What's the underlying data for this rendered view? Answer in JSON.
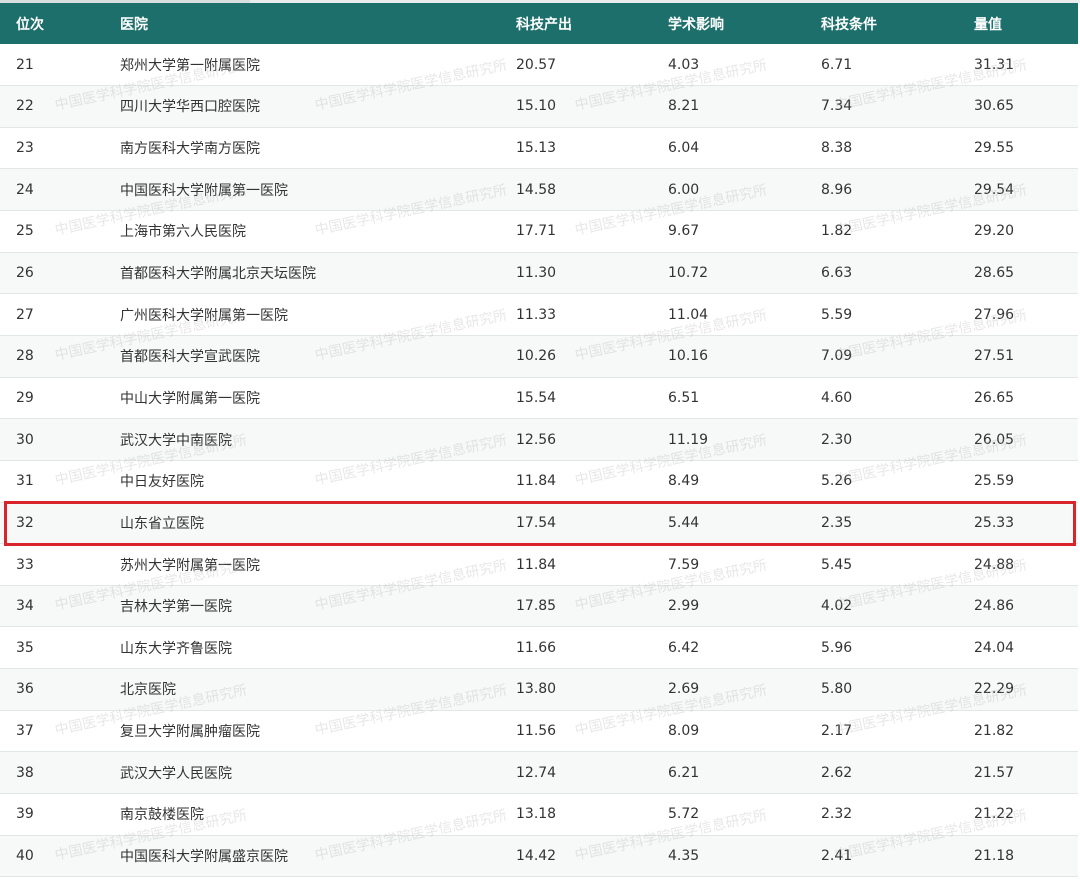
{
  "table": {
    "headers": {
      "rank": "位次",
      "hospital": "医院",
      "sci_output": "科技产出",
      "academic_impact": "学术影响",
      "sci_conditions": "科技条件",
      "score": "量值"
    },
    "rows": [
      {
        "rank": "21",
        "hospital": "郑州大学第一附属医院",
        "sci_output": "20.57",
        "academic_impact": "4.03",
        "sci_conditions": "6.71",
        "score": "31.31"
      },
      {
        "rank": "22",
        "hospital": "四川大学华西口腔医院",
        "sci_output": "15.10",
        "academic_impact": "8.21",
        "sci_conditions": "7.34",
        "score": "30.65"
      },
      {
        "rank": "23",
        "hospital": "南方医科大学南方医院",
        "sci_output": "15.13",
        "academic_impact": "6.04",
        "sci_conditions": "8.38",
        "score": "29.55"
      },
      {
        "rank": "24",
        "hospital": "中国医科大学附属第一医院",
        "sci_output": "14.58",
        "academic_impact": "6.00",
        "sci_conditions": "8.96",
        "score": "29.54"
      },
      {
        "rank": "25",
        "hospital": "上海市第六人民医院",
        "sci_output": "17.71",
        "academic_impact": "9.67",
        "sci_conditions": "1.82",
        "score": "29.20"
      },
      {
        "rank": "26",
        "hospital": "首都医科大学附属北京天坛医院",
        "sci_output": "11.30",
        "academic_impact": "10.72",
        "sci_conditions": "6.63",
        "score": "28.65"
      },
      {
        "rank": "27",
        "hospital": "广州医科大学附属第一医院",
        "sci_output": "11.33",
        "academic_impact": "11.04",
        "sci_conditions": "5.59",
        "score": "27.96"
      },
      {
        "rank": "28",
        "hospital": "首都医科大学宣武医院",
        "sci_output": "10.26",
        "academic_impact": "10.16",
        "sci_conditions": "7.09",
        "score": "27.51"
      },
      {
        "rank": "29",
        "hospital": "中山大学附属第一医院",
        "sci_output": "15.54",
        "academic_impact": "6.51",
        "sci_conditions": "4.60",
        "score": "26.65"
      },
      {
        "rank": "30",
        "hospital": "武汉大学中南医院",
        "sci_output": "12.56",
        "academic_impact": "11.19",
        "sci_conditions": "2.30",
        "score": "26.05"
      },
      {
        "rank": "31",
        "hospital": "中日友好医院",
        "sci_output": "11.84",
        "academic_impact": "8.49",
        "sci_conditions": "5.26",
        "score": "25.59"
      },
      {
        "rank": "32",
        "hospital": "山东省立医院",
        "sci_output": "17.54",
        "academic_impact": "5.44",
        "sci_conditions": "2.35",
        "score": "25.33"
      },
      {
        "rank": "33",
        "hospital": "苏州大学附属第一医院",
        "sci_output": "11.84",
        "academic_impact": "7.59",
        "sci_conditions": "5.45",
        "score": "24.88"
      },
      {
        "rank": "34",
        "hospital": "吉林大学第一医院",
        "sci_output": "17.85",
        "academic_impact": "2.99",
        "sci_conditions": "4.02",
        "score": "24.86"
      },
      {
        "rank": "35",
        "hospital": "山东大学齐鲁医院",
        "sci_output": "11.66",
        "academic_impact": "6.42",
        "sci_conditions": "5.96",
        "score": "24.04"
      },
      {
        "rank": "36",
        "hospital": "北京医院",
        "sci_output": "13.80",
        "academic_impact": "2.69",
        "sci_conditions": "5.80",
        "score": "22.29"
      },
      {
        "rank": "37",
        "hospital": "复旦大学附属肿瘤医院",
        "sci_output": "11.56",
        "academic_impact": "8.09",
        "sci_conditions": "2.17",
        "score": "21.82"
      },
      {
        "rank": "38",
        "hospital": "武汉大学人民医院",
        "sci_output": "12.74",
        "academic_impact": "6.21",
        "sci_conditions": "2.62",
        "score": "21.57"
      },
      {
        "rank": "39",
        "hospital": "南京鼓楼医院",
        "sci_output": "13.18",
        "academic_impact": "5.72",
        "sci_conditions": "2.32",
        "score": "21.22"
      },
      {
        "rank": "40",
        "hospital": "中国医科大学附属盛京医院",
        "sci_output": "14.42",
        "academic_impact": "4.35",
        "sci_conditions": "2.41",
        "score": "21.18"
      }
    ],
    "highlighted_rank": "32"
  },
  "watermark": {
    "text": "中国医学科学院医学信息研究所"
  },
  "colors": {
    "header_bg": "#1d6f6b",
    "highlight_border": "#d7252b"
  }
}
